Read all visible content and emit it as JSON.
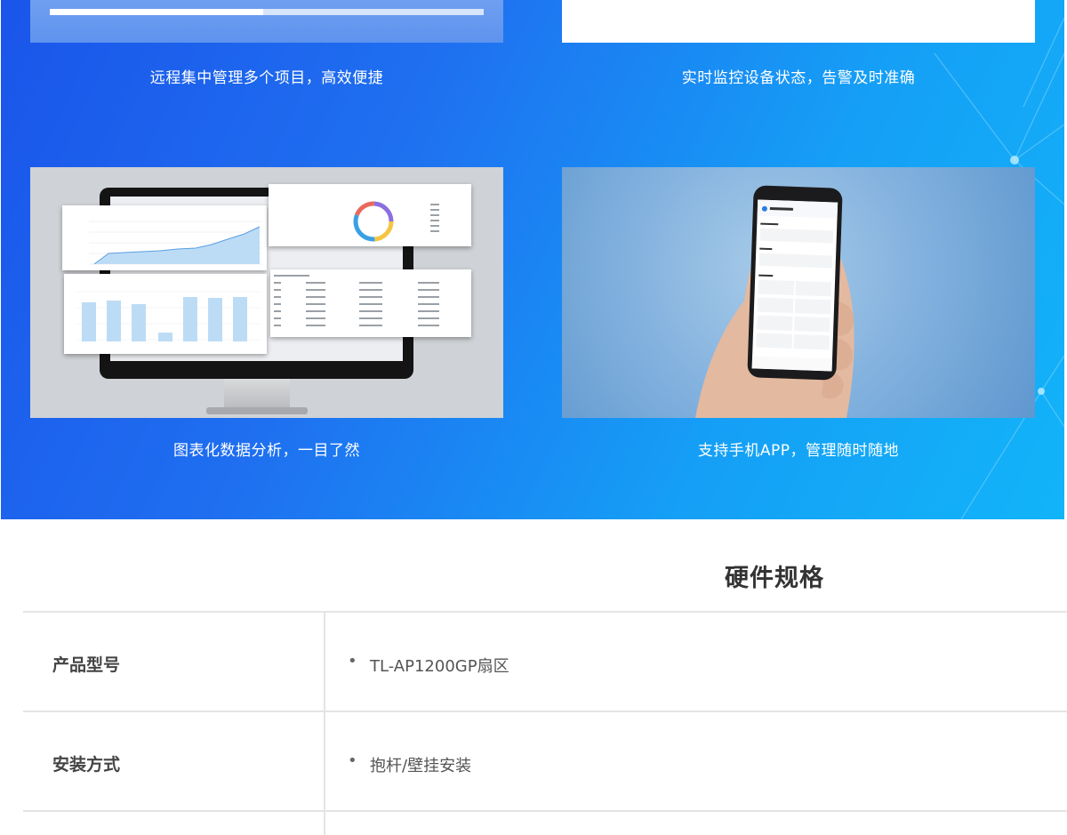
{
  "features": {
    "remote_management": "远程集中管理多个项目，高效便捷",
    "realtime_monitoring": "实时监控设备状态，告警及时准确",
    "data_analysis": "图表化数据分析，一目了然",
    "mobile_app": "支持手机APP，管理随时随地"
  },
  "spec": {
    "title": "硬件规格",
    "rows": [
      {
        "label": "产品型号",
        "bullet": "•",
        "value": "TL-AP1200GP扇区"
      },
      {
        "label": "安装方式",
        "bullet": "•",
        "value": "抱杆/壁挂安装"
      }
    ]
  },
  "colors": {
    "banner_start": "#1a55ea",
    "banner_end": "#12b4f8",
    "chart_fill": "#bcdcf6",
    "text_dark": "#333333"
  }
}
